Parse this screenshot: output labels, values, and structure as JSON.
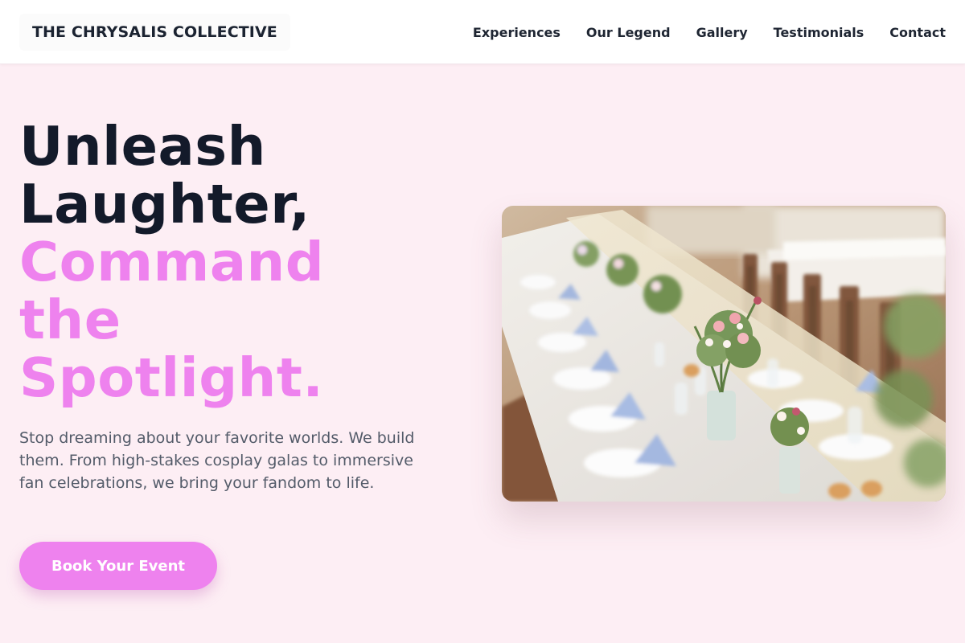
{
  "header": {
    "brand": "THE CHRYSALIS COLLECTIVE",
    "nav": [
      {
        "label": "Experiences"
      },
      {
        "label": "Our Legend"
      },
      {
        "label": "Gallery"
      },
      {
        "label": "Testimonials"
      },
      {
        "label": "Contact"
      }
    ]
  },
  "hero": {
    "title_line1": "Unleash",
    "title_line2": "Laughter,",
    "accent_line1": "Command",
    "accent_line2": "the",
    "accent_line3": "Spotlight.",
    "description": "Stop dreaming about your favorite worlds. We build them. From high-stakes cosplay galas to immersive fan celebrations, we bring your fandom to life.",
    "cta_label": "Book Your Event"
  },
  "colors": {
    "accent": "#ee82ee",
    "page_background": "#fdeef4",
    "heading_dark": "#131a2a",
    "body_text": "#535b69"
  },
  "icons": {
    "photo": "banquet-table-photo"
  }
}
